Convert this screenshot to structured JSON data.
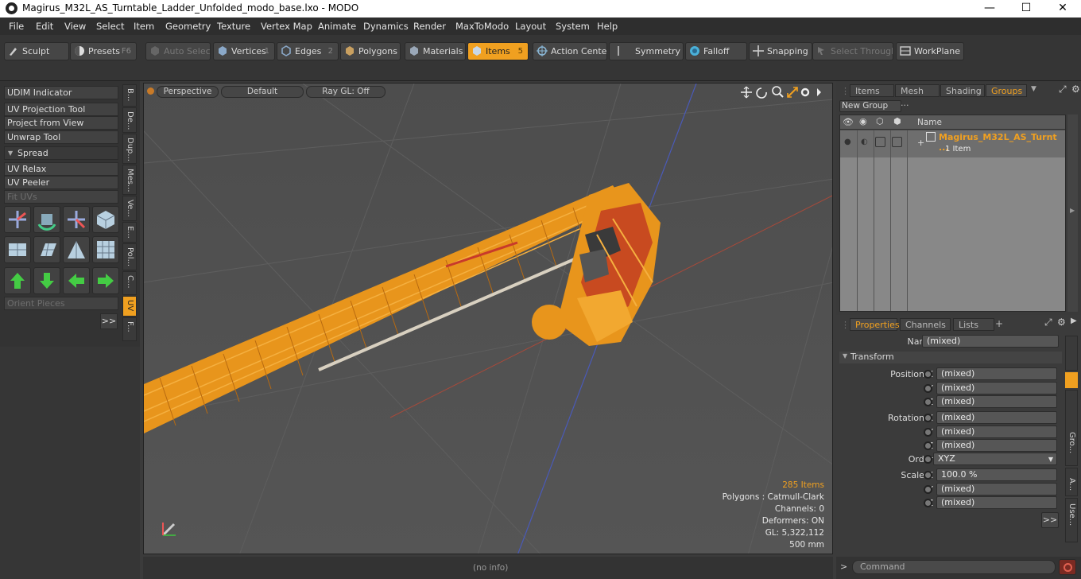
{
  "window": {
    "title": "Magirus_M32L_AS_Turntable_Ladder_Unfolded_modo_base.lxo - MODO",
    "minimize": "—",
    "maximize": "☐",
    "close": "✕"
  },
  "menu": [
    "File",
    "Edit",
    "View",
    "Select",
    "Item",
    "Geometry",
    "Texture",
    "Vertex Map",
    "Animate",
    "Dynamics",
    "Render",
    "MaxToModo",
    "Layout",
    "System",
    "Help"
  ],
  "toolbar": {
    "sculpt": "Sculpt",
    "presets": "Presets",
    "presets_key": "F6",
    "auto_select": "Auto Select",
    "vertices": "Vertices",
    "vertices_key": "1",
    "edges": "Edges",
    "edges_key": "2",
    "polygons": "Polygons",
    "materials": "Materials",
    "items": "Items",
    "items_key": "5",
    "action_center": "Action Center",
    "symmetry": "Symmetry",
    "falloff": "Falloff",
    "snapping": "Snapping",
    "select_through": "Select Through",
    "workplane": "WorkPlane"
  },
  "left": {
    "udim": "UDIM Indicator",
    "uv_projection": "UV Projection Tool",
    "project_from_view": "Project from View",
    "unwrap": "Unwrap Tool",
    "spread": "Spread",
    "uv_relax": "UV Relax",
    "uv_peeler": "UV Peeler",
    "fit_uvs": "Fit UVs",
    "orient": "Orient Pieces",
    "more": ">>",
    "vtabs": [
      "B...",
      "De...",
      "Dup...",
      "Mes...",
      "Ve...",
      "E...",
      "Pol...",
      "C...",
      "UV",
      "F..."
    ]
  },
  "viewport": {
    "perspective": "Perspective",
    "default": "Default",
    "raygl": "Ray GL: Off",
    "items_count": "285 Items",
    "polygons": "Polygons : Catmull-Clark",
    "channels": "Channels: 0",
    "deformers": "Deformers: ON",
    "gl": "GL: 5,322,112",
    "scale": "500 mm",
    "status": "(no info)"
  },
  "groups": {
    "tabs": [
      "Items",
      "Mesh ...",
      "Shading",
      "Groups"
    ],
    "new_group": "New Group",
    "col_name": "Name",
    "item_name": "Magirus_M32L_AS_Turnt ...",
    "item_sub": "1 Item"
  },
  "props": {
    "tabs": [
      "Properties",
      "Channels",
      "Lists"
    ],
    "add": "+",
    "name_label": "Name",
    "name_value": "(mixed)",
    "transform": "Transform",
    "pos_x": "Position X",
    "y": "Y",
    "z": "Z",
    "rot_x": "Rotation X",
    "order": "Order",
    "order_value": "XYZ",
    "scale_x": "Scale X",
    "scale_value": "100.0 %",
    "mixed": "(mixed)",
    "more": ">>",
    "side_tabs": [
      "Gro...",
      "A...",
      "Use..."
    ]
  },
  "command": {
    "prompt": ">",
    "placeholder": "Command"
  }
}
